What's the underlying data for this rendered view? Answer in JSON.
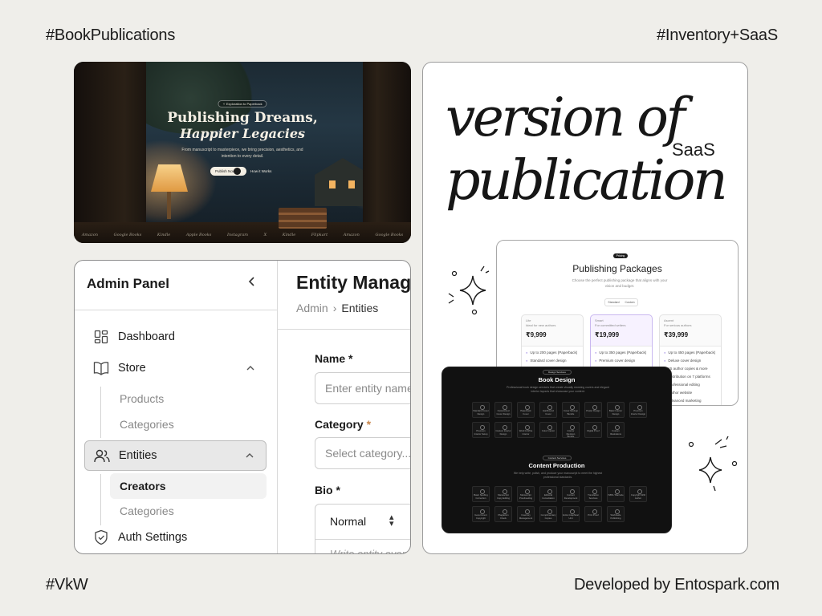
{
  "corners": {
    "top_left": "#BookPublications",
    "top_right": "#Inventory+SaaS",
    "bottom_left": "#VkW",
    "bottom_right": "Developed by Entospark.com"
  },
  "hero": {
    "badge": "✧ Exploration to Paperback",
    "title_line1": "Publishing Dreams,",
    "title_line2": "Happier Legacies",
    "description": "From manuscript to masterpiece, we bring precision, aesthetics, and intention to every detail.",
    "cta_primary": "Publish Now",
    "cta_secondary": "How it Works",
    "brands": [
      "Amazon",
      "Google Books",
      "Kindle",
      "Apple Books",
      "Instagram",
      "X",
      "Kindle",
      "Flipkart",
      "Amazon",
      "Google Books"
    ]
  },
  "typography": {
    "line1": "version of",
    "line2": "publication",
    "tag": "SaaS"
  },
  "packages": {
    "tag": "Pricing",
    "title": "Publishing Packages",
    "subtitle": "Choose the perfect publishing package that aligns with your vision and budget.",
    "toggle": [
      "Standard",
      "Custom"
    ],
    "plans": [
      {
        "name": "Lite",
        "note": "Ideal for new authors",
        "price": "₹9,999",
        "features": [
          "Up to 200 pages (Paperback)",
          "Standard cover design",
          "5 author copies"
        ]
      },
      {
        "name": "Smart",
        "note": "For committed writers",
        "price": "₹19,999",
        "features": [
          "Up to 350 pages (Paperback)",
          "Premium cover design",
          "10 author copies"
        ]
      },
      {
        "name": "Ascent",
        "note": "For serious authors",
        "price": "₹39,999",
        "features": [
          "Up to 450 pages (Paperback)",
          "Deluxe cover design",
          "15 author copies & more",
          "Distribution on 7 platforms",
          "Professional editing",
          "Author website",
          "Advanced marketing"
        ]
      }
    ]
  },
  "services": {
    "design_tag": "Design Services",
    "design_title": "Book Design",
    "design_sub": "Professional book design services that create visually stunning covers and elegant interior layouts that showcase your content.",
    "design_items": [
      "Standard Cover Design",
      "Customized Cover Design",
      "Paperback Cover",
      "Hardbound Cover",
      "Cover Mockup Bundle",
      "Poster Design",
      "Basic Interior Design",
      "Premium Interior Design",
      "Premium Interior Setup",
      "Custom Interior Design",
      "Word & Write Interior",
      "Color Interior",
      "Interior Revision Bundle",
      "Digital Proof",
      "Custom Illustrations"
    ],
    "content_tag": "Content Services",
    "content_title": "Content Production",
    "content_sub": "We help write, polish, and produce your manuscript to meet the highest professional standards.",
    "content_items": [
      "Basic Spelling Correction",
      "Manuscript Copy Editing",
      "Manuscript Proofreading",
      "Editorial Consultation",
      "Content Development",
      "Translation Services",
      "ISBN / Barcode",
      "Copyright With Author",
      "Government Copyright",
      "Plagiarism Check",
      "Inventory Management",
      "Complimentary Copies",
      "Extra Graphical Unit",
      "Print Proof",
      "Worldwide Publishing"
    ]
  },
  "admin": {
    "panel_title": "Admin Panel",
    "nav": [
      {
        "label": "Dashboard"
      },
      {
        "label": "Store",
        "children": [
          "Products",
          "Categories"
        ]
      },
      {
        "label": "Entities",
        "children": [
          "Creators",
          "Categories"
        ]
      },
      {
        "label": "Auth Settings"
      }
    ],
    "page_title": "Entity Management",
    "breadcrumb": [
      "Admin",
      "Entities"
    ],
    "form": {
      "name_label": "Name",
      "name_placeholder": "Enter entity name",
      "category_label": "Category",
      "category_placeholder": "Select category...",
      "bio_label": "Bio",
      "format_value": "Normal",
      "bio_placeholder": "Write entity overview..."
    }
  }
}
